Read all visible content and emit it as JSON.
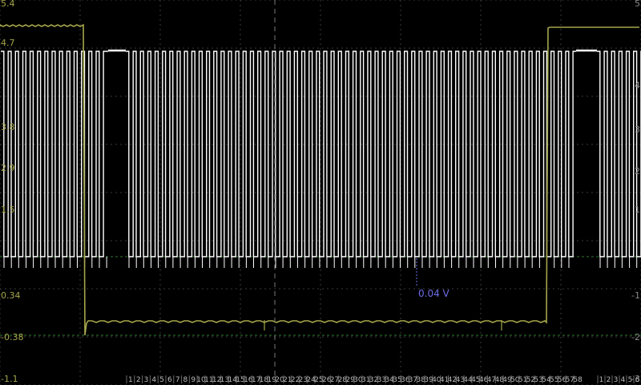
{
  "scope": {
    "colors": {
      "background": "#000000",
      "grid": "#3a3a3a",
      "ch_a": "#a4a64a",
      "ch_b": "#ffffff",
      "cursor": "#6d6de8",
      "ref_b": "#2f7a2f",
      "ref_a": "#2f7a2f"
    },
    "left_axis_labels": [
      "5.4",
      "4.7",
      "3.8",
      "2.9",
      "1.5",
      "0.34",
      "-0.38",
      "-1.1"
    ],
    "right_axis_labels": [
      "5",
      "4",
      "3",
      "2",
      "1",
      "-1",
      "-2",
      "-3"
    ],
    "cursor_label": "0.04 V",
    "decode_labels_left": [
      "1",
      "2",
      "3",
      "4",
      "5",
      "6",
      "7",
      "8",
      "9",
      "10",
      "11",
      "12",
      "13",
      "14",
      "15",
      "16",
      "17",
      "18",
      "19",
      "20",
      "21",
      "22",
      "23",
      "24",
      "25",
      "26",
      "27",
      "28",
      "29",
      "30",
      "31",
      "32",
      "33",
      "34",
      "35",
      "36",
      "37",
      "38",
      "39",
      "40",
      "41",
      "42",
      "43",
      "44",
      "45",
      "46",
      "47",
      "48",
      "49",
      "50",
      "51",
      "52",
      "53",
      "54",
      "55",
      "56",
      "57",
      "58"
    ],
    "decode_labels_right": [
      "1",
      "2",
      "3",
      "4",
      "5",
      "6"
    ]
  }
}
